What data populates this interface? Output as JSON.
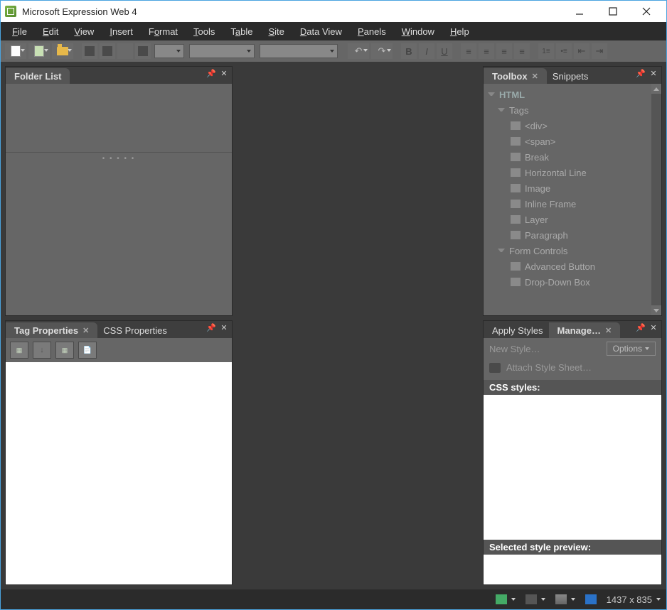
{
  "window": {
    "title": "Microsoft Expression Web 4"
  },
  "menu": [
    "File",
    "Edit",
    "View",
    "Insert",
    "Format",
    "Tools",
    "Table",
    "Site",
    "Data View",
    "Panels",
    "Window",
    "Help"
  ],
  "panels": {
    "folder_list": {
      "title": "Folder List"
    },
    "tag_properties": {
      "tab1": "Tag Properties",
      "tab2": "CSS Properties"
    },
    "toolbox": {
      "tab1": "Toolbox",
      "tab2": "Snippets",
      "root": "HTML",
      "groups": [
        {
          "name": "Tags",
          "items": [
            "<div>",
            "<span>",
            "Break",
            "Horizontal Line",
            "Image",
            "Inline Frame",
            "Layer",
            "Paragraph"
          ]
        },
        {
          "name": "Form Controls",
          "items": [
            "Advanced Button",
            "Drop-Down Box"
          ]
        }
      ]
    },
    "styles": {
      "tab1": "Apply Styles",
      "tab2": "Manage…",
      "new_style": "New Style…",
      "options": "Options",
      "attach": "Attach Style Sheet…",
      "css_header": "CSS styles:",
      "preview_header": "Selected style preview:"
    }
  },
  "statusbar": {
    "dimensions": "1437 x 835"
  }
}
